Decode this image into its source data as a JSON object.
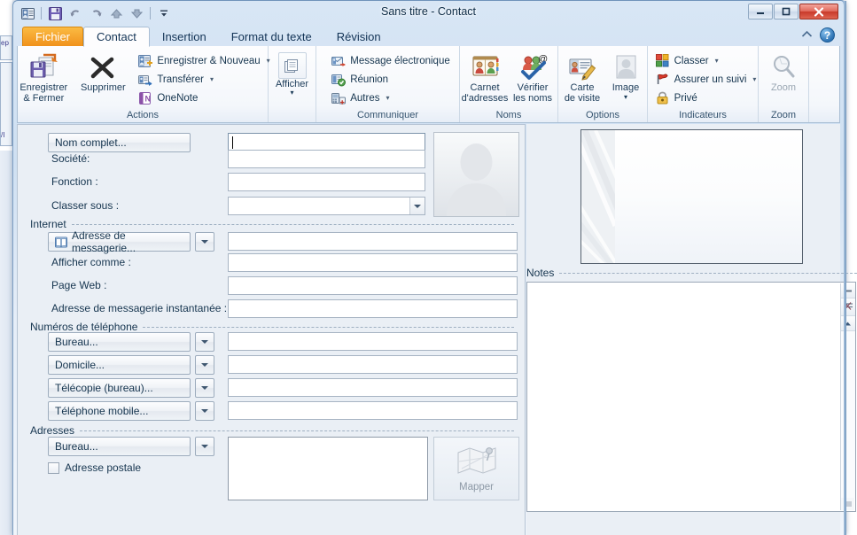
{
  "window": {
    "title": "Sans titre  -  Contact",
    "buttons": {
      "minimize": "minimize-icon",
      "maximize": "maximize-icon",
      "close": "close-icon"
    }
  },
  "quick_access": {
    "items": [
      {
        "name": "contact-card-icon"
      },
      {
        "name": "save-icon"
      },
      {
        "name": "undo-icon"
      },
      {
        "name": "redo-icon"
      },
      {
        "name": "previous-item-icon"
      },
      {
        "name": "next-item-icon"
      },
      {
        "name": "customize-qat-icon"
      }
    ]
  },
  "tabs": [
    {
      "id": "fichier",
      "label": "Fichier",
      "active": false,
      "file": true
    },
    {
      "id": "contact",
      "label": "Contact",
      "active": true
    },
    {
      "id": "insertion",
      "label": "Insertion",
      "active": false
    },
    {
      "id": "format",
      "label": "Format du texte",
      "active": false
    },
    {
      "id": "revision",
      "label": "Révision",
      "active": false
    }
  ],
  "tab_right": {
    "collapse": "▲",
    "help": "?"
  },
  "ribbon": {
    "groups": [
      {
        "id": "actions",
        "label": "Actions",
        "big": [
          {
            "label": "Enregistrer\n& Fermer",
            "label_line1": "Enregistrer",
            "label_line2": "& Fermer",
            "icon": "save-and-close-icon"
          },
          {
            "label": "Supprimer",
            "label_line1": "Supprimer",
            "label_line2": "",
            "icon": "delete-x-icon"
          }
        ],
        "small": [
          {
            "label": "Enregistrer & Nouveau",
            "icon": "save-new-icon",
            "caret": true
          },
          {
            "label": "Transférer",
            "icon": "forward-icon",
            "caret": true
          },
          {
            "label": "OneNote",
            "icon": "onenote-icon",
            "caret": false
          }
        ]
      },
      {
        "id": "afficher",
        "label": "",
        "big": [
          {
            "label_line1": "Afficher",
            "label_line2": "▾",
            "icon": "show-pages-icon"
          }
        ],
        "small": []
      },
      {
        "id": "communiquer",
        "label": "Communiquer",
        "big": [],
        "small": [
          {
            "label": "Message électronique",
            "icon": "email-icon",
            "caret": false
          },
          {
            "label": "Réunion",
            "icon": "meeting-icon",
            "caret": false
          },
          {
            "label": "Autres",
            "icon": "more-icon",
            "caret": true
          }
        ]
      },
      {
        "id": "noms",
        "label": "Noms",
        "big": [
          {
            "label_line1": "Carnet",
            "label_line2": "d'adresses",
            "icon": "address-book-icon"
          },
          {
            "label_line1": "Vérifier",
            "label_line2": "les noms",
            "icon": "check-names-icon"
          }
        ],
        "small": []
      },
      {
        "id": "options",
        "label": "Options",
        "big": [
          {
            "label_line1": "Carte",
            "label_line2": "de visite",
            "icon": "business-card-icon"
          },
          {
            "label_line1": "Image",
            "label_line2": "▾",
            "icon": "picture-icon"
          }
        ],
        "small": []
      },
      {
        "id": "indicateurs",
        "label": "Indicateurs",
        "big": [],
        "small": [
          {
            "label": "Classer",
            "icon": "categorize-icon",
            "caret": true
          },
          {
            "label": "Assurer un suivi",
            "icon": "follow-up-flag-icon",
            "caret": true
          },
          {
            "label": "Privé",
            "icon": "private-lock-icon",
            "caret": false
          }
        ]
      },
      {
        "id": "zoom",
        "label": "Zoom",
        "big": [
          {
            "label_line1": "Zoom",
            "label_line2": "",
            "icon": "zoom-magnifier-icon",
            "disabled": true
          }
        ],
        "small": []
      }
    ]
  },
  "form": {
    "fields": {
      "nom_complet_button": "Nom complet...",
      "nom_complet_value": "",
      "societe_label": "Société:",
      "societe_value": "",
      "fonction_label": "Fonction :",
      "fonction_value": "",
      "classer_sous_label": "Classer sous :",
      "classer_sous_value": ""
    },
    "sections": {
      "internet": "Internet",
      "telephone": "Numéros de téléphone",
      "adresses": "Adresses"
    },
    "internet": {
      "email_button": "Adresse de messagerie...",
      "email_value": "",
      "afficher_comme_label": "Afficher comme :",
      "afficher_comme_value": "",
      "page_web_label": "Page Web :",
      "page_web_value": "",
      "im_label": "Adresse de messagerie instantanée :",
      "im_value": ""
    },
    "phones": [
      {
        "button": "Bureau...",
        "value": ""
      },
      {
        "button": "Domicile...",
        "value": ""
      },
      {
        "button": "Télécopie (bureau)...",
        "value": ""
      },
      {
        "button": "Téléphone mobile...",
        "value": ""
      }
    ],
    "address": {
      "button": "Bureau...",
      "value": "",
      "checkbox_label": "Adresse postale",
      "checkbox_checked": false,
      "map_button": "Mapper"
    },
    "photo_placeholder": "contact-photo-placeholder"
  },
  "right_pane": {
    "business_card_preview": "business-card-preview",
    "notes_label": "Notes",
    "notes_value": ""
  },
  "colors": {
    "file_tab": "#f0901a",
    "close_button": "#c8392a",
    "ribbon_bg": "#f4f7fb",
    "form_bg": "#eaeff5",
    "accent_blue": "#2d73b4"
  }
}
